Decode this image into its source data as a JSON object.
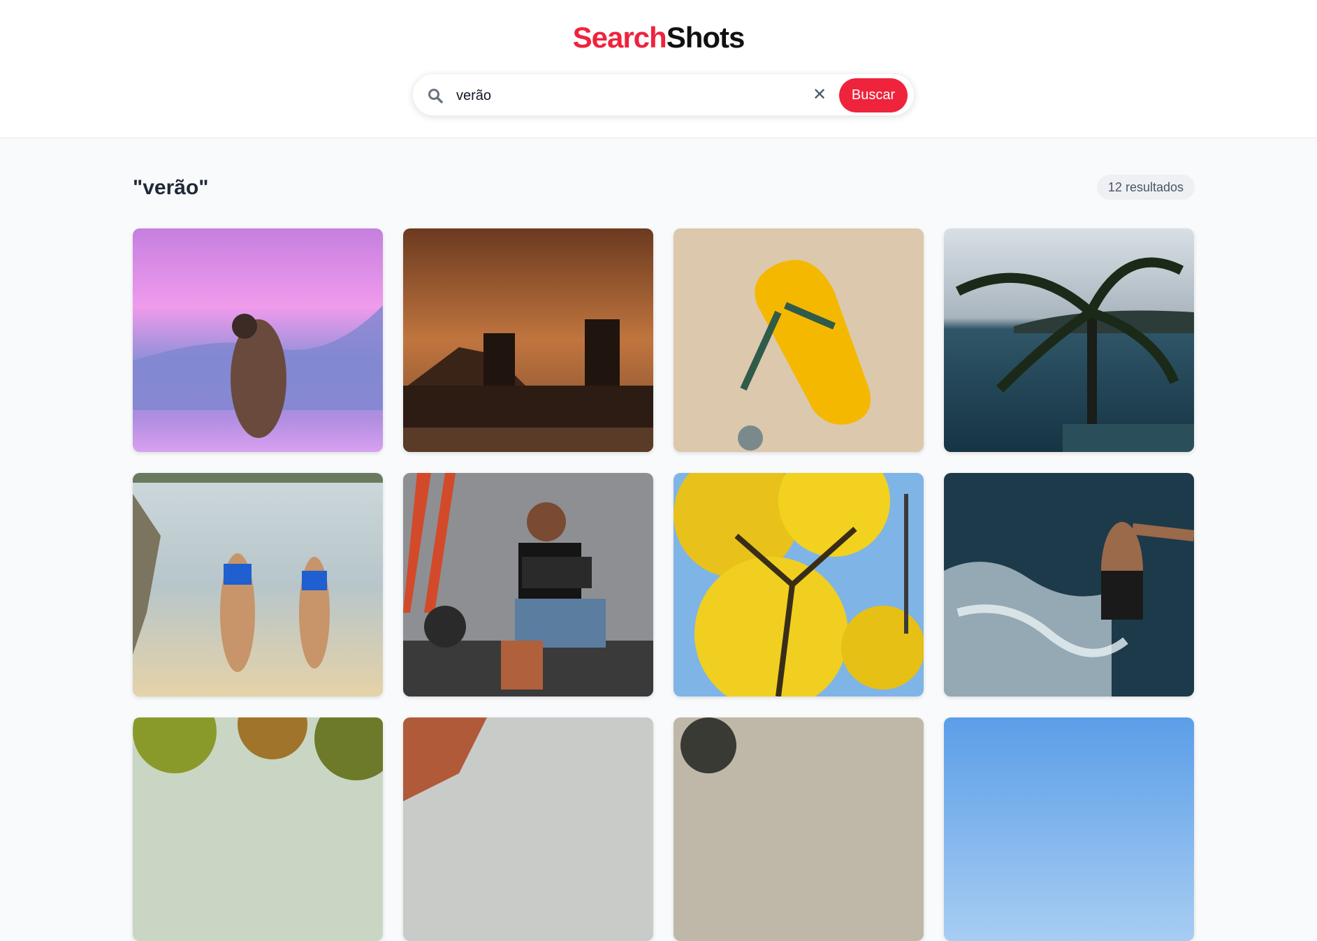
{
  "header": {
    "logo_part1": "Search",
    "logo_part2": "Shots"
  },
  "search": {
    "value": "verão",
    "placeholder": "",
    "clear_icon": "close-icon",
    "button_label": "Buscar",
    "icon": "search-icon"
  },
  "results": {
    "query_label": "\"verão\"",
    "count_label": "12 resultados"
  },
  "photos": [
    {
      "name": "photo-woman-bikini-pink-sky"
    },
    {
      "name": "photo-city-skyline-sunset"
    },
    {
      "name": "photo-yellow-flip-flop-sand"
    },
    {
      "name": "photo-palm-tree-sea"
    },
    {
      "name": "photo-two-women-beach"
    },
    {
      "name": "photo-man-with-camera"
    },
    {
      "name": "photo-yellow-ipe-tree"
    },
    {
      "name": "photo-man-diving-water"
    },
    {
      "name": "photo-tree-foliage"
    },
    {
      "name": "photo-rock-cliff"
    },
    {
      "name": "photo-person-landscape"
    },
    {
      "name": "photo-blue-sky"
    }
  ],
  "colors": {
    "accent": "#ef233c",
    "logo_dark": "#111111"
  }
}
